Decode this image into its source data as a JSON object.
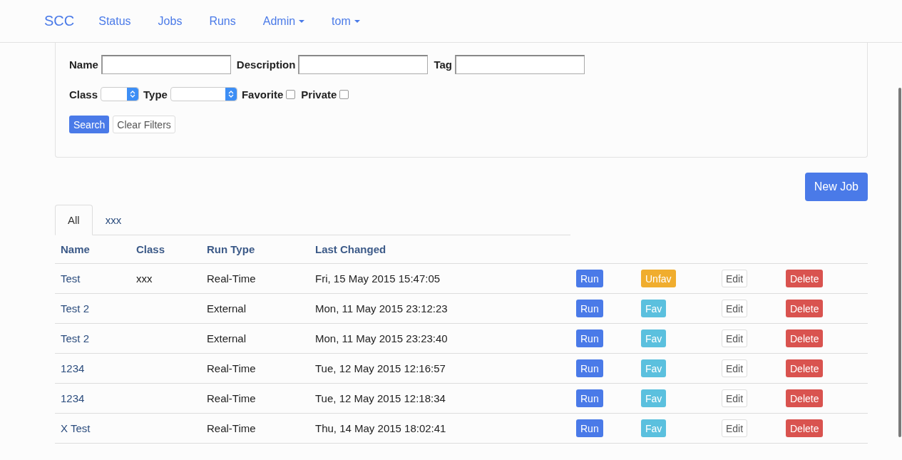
{
  "navbar": {
    "brand": "SCC",
    "links": [
      {
        "label": "Status",
        "dropdown": false
      },
      {
        "label": "Jobs",
        "dropdown": false
      },
      {
        "label": "Runs",
        "dropdown": false
      },
      {
        "label": "Admin",
        "dropdown": true
      },
      {
        "label": "tom",
        "dropdown": true
      }
    ]
  },
  "search_options": {
    "fields": [
      {
        "label": "Name",
        "kind": "text"
      },
      {
        "label": "Description",
        "kind": "text"
      },
      {
        "label": "Tag",
        "kind": "text"
      }
    ],
    "filters": [
      {
        "label": "Class",
        "kind": "select"
      },
      {
        "label": "Type",
        "kind": "select"
      },
      {
        "label": "Favorite",
        "kind": "checkbox",
        "checked": false
      },
      {
        "label": "Private",
        "kind": "checkbox",
        "checked": false
      }
    ],
    "buttons": [
      {
        "label": "Search",
        "kind": "primary"
      },
      {
        "label": "Clear Filters",
        "kind": "default"
      }
    ]
  },
  "new_job_button": "New Job",
  "tabs": [
    {
      "label": "All",
      "selected": true
    },
    {
      "label": "xxx",
      "selected": false
    }
  ],
  "table": {
    "columns": [
      "Name",
      "Class",
      "Run Type",
      "Last Changed"
    ],
    "rows": [
      {
        "name": "Test",
        "class": "xxx",
        "run_type": "Real-Time",
        "last_changed": "Fri, 15 May 2015 15:47:05",
        "run": "Run",
        "favorite": true,
        "fav": "Unfav",
        "edit": "Edit",
        "delete": "Delete"
      },
      {
        "name": "Test 2",
        "run_type": "External",
        "last_changed": "Mon, 11 May 2015 23:12:23",
        "run": "Run",
        "favorite": false,
        "fav": "Fav",
        "edit": "Edit",
        "delete": "Delete"
      },
      {
        "name": "Test 2",
        "run_type": "External",
        "last_changed": "Mon, 11 May 2015 23:23:40",
        "run": "Run",
        "favorite": false,
        "fav": "Fav",
        "edit": "Edit",
        "delete": "Delete"
      },
      {
        "name": "1234",
        "run_type": "Real-Time",
        "last_changed": "Tue, 12 May 2015 12:16:57",
        "run": "Run",
        "favorite": false,
        "fav": "Fav",
        "edit": "Edit",
        "delete": "Delete"
      },
      {
        "name": "1234",
        "run_type": "Real-Time",
        "last_changed": "Tue, 12 May 2015 12:18:34",
        "run": "Run",
        "favorite": false,
        "fav": "Fav",
        "edit": "Edit",
        "delete": "Delete"
      },
      {
        "name": "X Test",
        "run_type": "Real-Time",
        "last_changed": "Thu, 14 May 2015 18:02:41",
        "run": "Run",
        "favorite": false,
        "fav": "Fav",
        "edit": "Edit",
        "delete": "Delete"
      }
    ]
  }
}
